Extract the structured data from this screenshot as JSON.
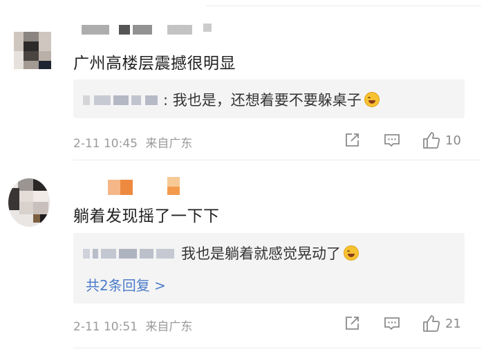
{
  "comments": [
    {
      "text": "广州高楼层震撼很明显",
      "reply": {
        "text": ": 我也是，还想着要不要躲桌子"
      },
      "time": "2-11 10:45",
      "location": "来自广东",
      "like_count": "10"
    },
    {
      "text": "躺着发现摇了一下下",
      "reply": {
        "text": "我也是躺着就感觉晃动了",
        "more": "共2条回复 >"
      },
      "time": "2-11 10:51",
      "location": "来自广东",
      "like_count": "21"
    }
  ],
  "icons": [
    "share-icon",
    "comment-icon",
    "like-icon"
  ],
  "colors": {
    "link": "#4a7bc8",
    "meta": "#9a9a9a",
    "reply_bg": "#f4f4f5"
  }
}
